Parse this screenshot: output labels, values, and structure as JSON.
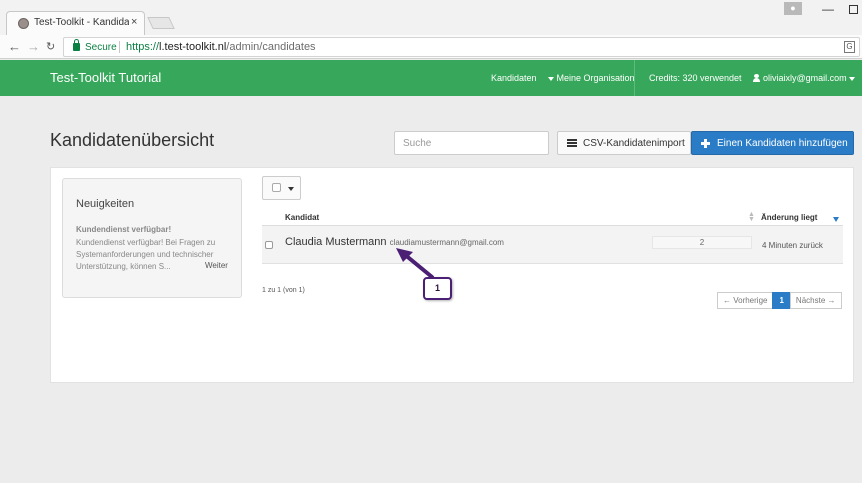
{
  "browser": {
    "tab_title": "Test-Toolkit - Kandidaten",
    "tab_close": "×",
    "secure_label": "Secure",
    "url_scheme": "https://",
    "url_host": "l.test-toolkit.nl",
    "url_path": "/admin/candidates",
    "nav_back": "←",
    "nav_forward": "→",
    "nav_reload": "C",
    "window_minimize": "—"
  },
  "navbar": {
    "brand": "Test-Toolkit Tutorial",
    "kandidaten": "Kandidaten",
    "organisation": "Meine Organisation",
    "credits": "Credits: 320 verwendet",
    "user_email": "oliviaixly@gmail.com",
    "bg_color": "#37a85b"
  },
  "header": {
    "title": "Kandidatenübersicht",
    "search_placeholder": "Suche",
    "import_label": "CSV-Kandidatenimport",
    "add_label": "Einen Kandidaten hinzufügen",
    "accent_color": "#2a7cc7"
  },
  "news": {
    "title": "Neuigkeiten",
    "headline": "Kundendienst verfügbar!",
    "body": "Kundendienst verfügbar! Bei Fragen zu Systemanforderungen und technischer Unterstützung, können S...",
    "more": "Weiter"
  },
  "table": {
    "col_candidate": "Kandidat",
    "col_change": "Änderung liegt",
    "rows": [
      {
        "name": "Claudia Mustermann",
        "email": "claudiamustermann@gmail.com",
        "score": "2",
        "time": "4 Minuten zurück"
      }
    ],
    "summary": "1 zu 1 (von 1)"
  },
  "pagination": {
    "prev": "← Vorherige",
    "current": "1",
    "next": "Nächste →"
  },
  "annotation": {
    "label": "1",
    "color": "#4b1f73"
  }
}
